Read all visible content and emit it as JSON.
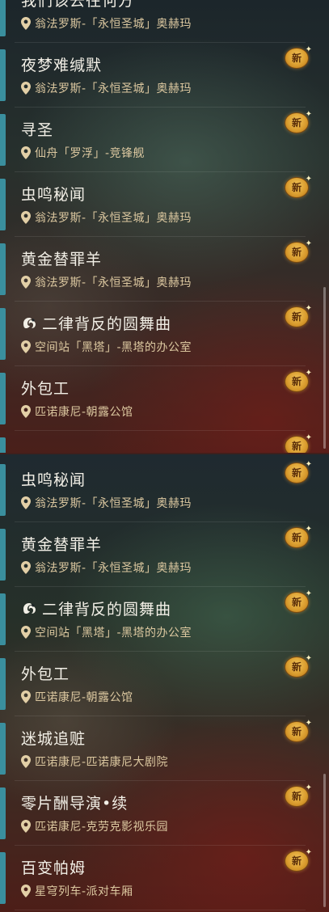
{
  "badge_label": "新",
  "panel_top": {
    "missions": [
      {
        "title": "我们该去往何方",
        "location": "翁法罗斯-「永恒圣城」奥赫玛",
        "badge": false,
        "icon": null
      },
      {
        "title": "夜梦难缄默",
        "location": "翁法罗斯-「永恒圣城」奥赫玛",
        "badge": true,
        "icon": null
      },
      {
        "title": "寻圣",
        "location": "仙舟「罗浮」-竞锋舰",
        "badge": true,
        "icon": null
      },
      {
        "title": "虫鸣秘闻",
        "location": "翁法罗斯-「永恒圣城」奥赫玛",
        "badge": true,
        "icon": null
      },
      {
        "title": "黄金替罪羊",
        "location": "翁法罗斯-「永恒圣城」奥赫玛",
        "badge": true,
        "icon": null
      },
      {
        "title": "二律背反的圆舞曲",
        "location": "空间站「黑塔」-黑塔的办公室",
        "badge": true,
        "icon": "mission-type-icon"
      },
      {
        "title": "外包工",
        "location": "匹诺康尼-朝露公馆",
        "badge": true,
        "icon": null
      },
      {
        "title": "",
        "location": "",
        "badge": true,
        "icon": null
      }
    ]
  },
  "panel_bottom": {
    "missions": [
      {
        "title": "虫鸣秘闻",
        "location": "翁法罗斯-「永恒圣城」奥赫玛",
        "badge": true,
        "icon": null
      },
      {
        "title": "黄金替罪羊",
        "location": "翁法罗斯-「永恒圣城」奥赫玛",
        "badge": true,
        "icon": null
      },
      {
        "title": "二律背反的圆舞曲",
        "location": "空间站「黑塔」-黑塔的办公室",
        "badge": true,
        "icon": "mission-type-icon"
      },
      {
        "title": "外包工",
        "location": "匹诺康尼-朝露公馆",
        "badge": true,
        "icon": null
      },
      {
        "title": "迷城追赃",
        "location": "匹诺康尼-匹诺康尼大剧院",
        "badge": true,
        "icon": null
      },
      {
        "title": "零片酬导演•续",
        "location": "匹诺康尼-克劳克影视乐园",
        "badge": true,
        "icon": null
      },
      {
        "title": "百变帕姆",
        "location": "星穹列车-派对车厢",
        "badge": true,
        "icon": null
      }
    ]
  },
  "colors": {
    "accent": "#3a8f9e",
    "title": "#f2efe6",
    "location": "#dcc8a0",
    "badge": "#e0a83a"
  }
}
